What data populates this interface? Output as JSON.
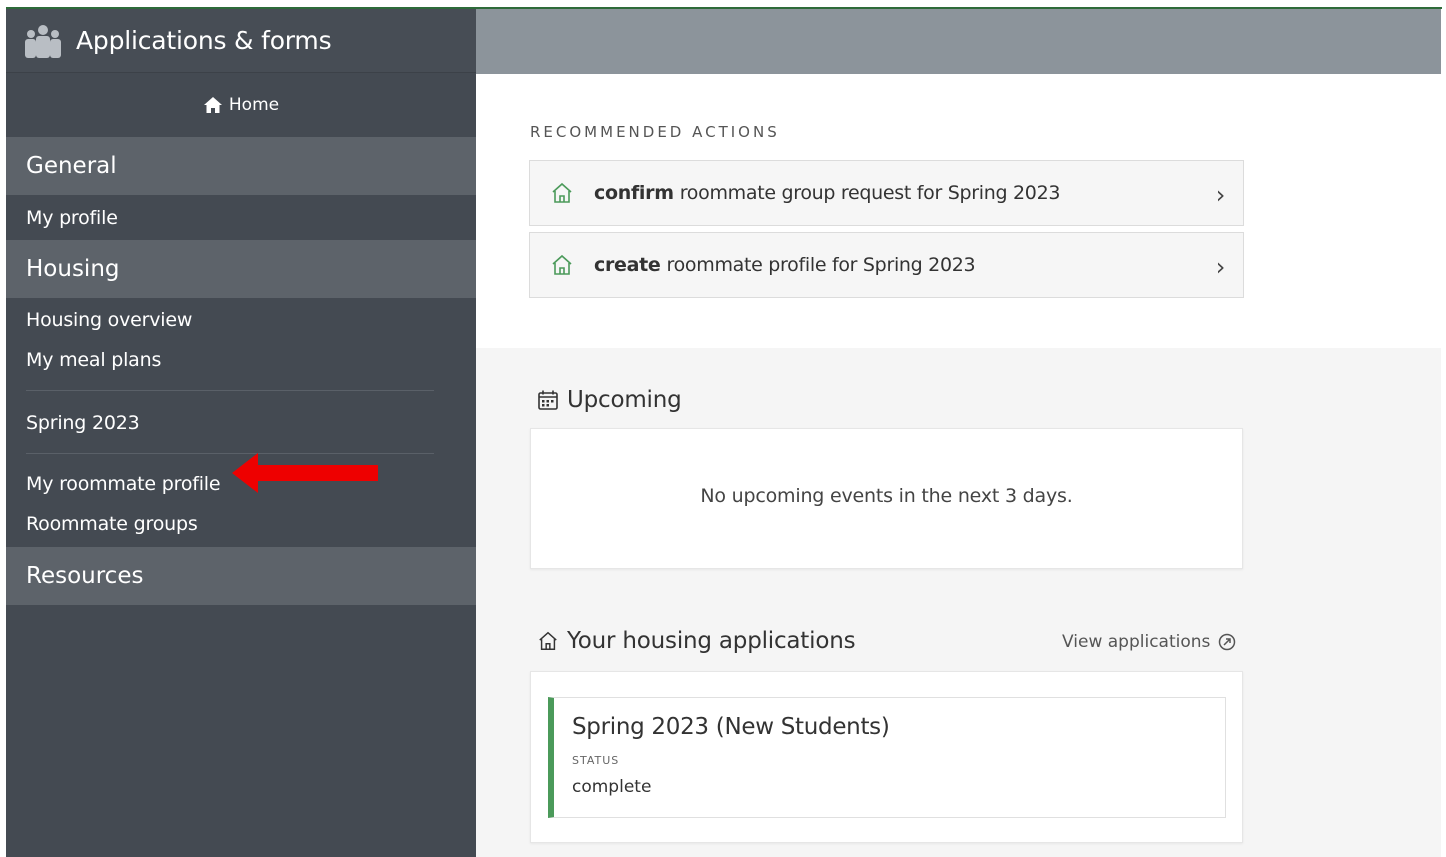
{
  "sidebar": {
    "title": "Applications & forms",
    "home": "Home",
    "sections": [
      {
        "label": "General"
      },
      {
        "label": "Housing"
      },
      {
        "label": "Resources"
      }
    ],
    "items": {
      "my_profile": "My profile",
      "housing_overview": "Housing overview",
      "my_meal_plans": "My meal plans",
      "spring_2023": "Spring 2023",
      "my_roommate_profile": "My roommate profile",
      "roommate_groups": "Roommate groups"
    },
    "icons": {
      "header": "people-icon",
      "home": "home-icon"
    },
    "annotation_arrow_color": "#ee0000"
  },
  "main": {
    "recommended_label": "RECOMMENDED ACTIONS",
    "actions": [
      {
        "verb": "confirm",
        "text": "roommate group request for Spring 2023",
        "icon": "house-icon",
        "chevron": "›"
      },
      {
        "verb": "create",
        "text": "roommate profile for Spring 2023",
        "icon": "house-icon",
        "chevron": "›"
      }
    ],
    "upcoming": {
      "title": "Upcoming",
      "icon": "calendar-icon",
      "empty_message": "No upcoming events in the next 3 days."
    },
    "applications": {
      "title": "Your housing applications",
      "icon": "house-icon",
      "view_link": "View applications",
      "items": [
        {
          "name": "Spring 2023 (New Students)",
          "status_label": "STATUS",
          "status": "complete",
          "accent": "#4b9a5a"
        }
      ]
    }
  },
  "colors": {
    "sidebar_bg": "#444a52",
    "section_bg": "#5d636a",
    "top_band": "#8c949b",
    "accent_green": "#4b9a5a"
  }
}
